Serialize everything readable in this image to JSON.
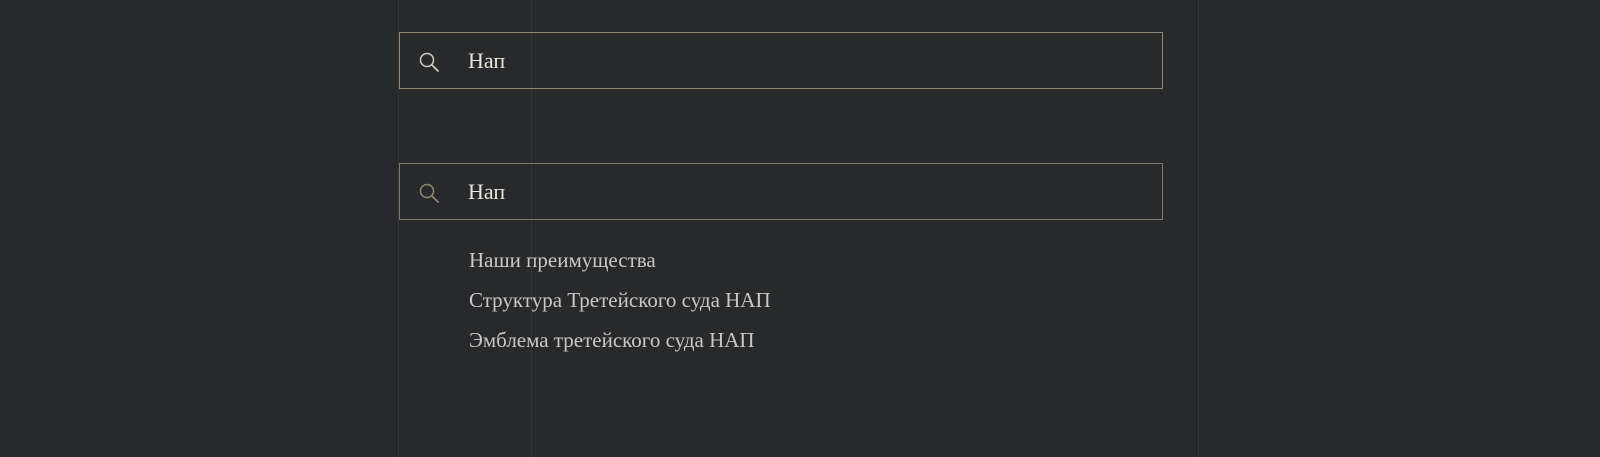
{
  "search_primary": {
    "value": "Нап",
    "icon": "search-icon"
  },
  "search_secondary": {
    "value": "Нап",
    "icon": "search-icon"
  },
  "suggestions": [
    {
      "label": "Наши преимущества"
    },
    {
      "label": "Структура Третейского суда НАП"
    },
    {
      "label": "Эмблема третейского суда НАП"
    }
  ],
  "colors": {
    "background": "#28292b",
    "border": "#8f8a6e",
    "text": "#e8e5dc",
    "suggestion_text": "#c9c8c2"
  }
}
